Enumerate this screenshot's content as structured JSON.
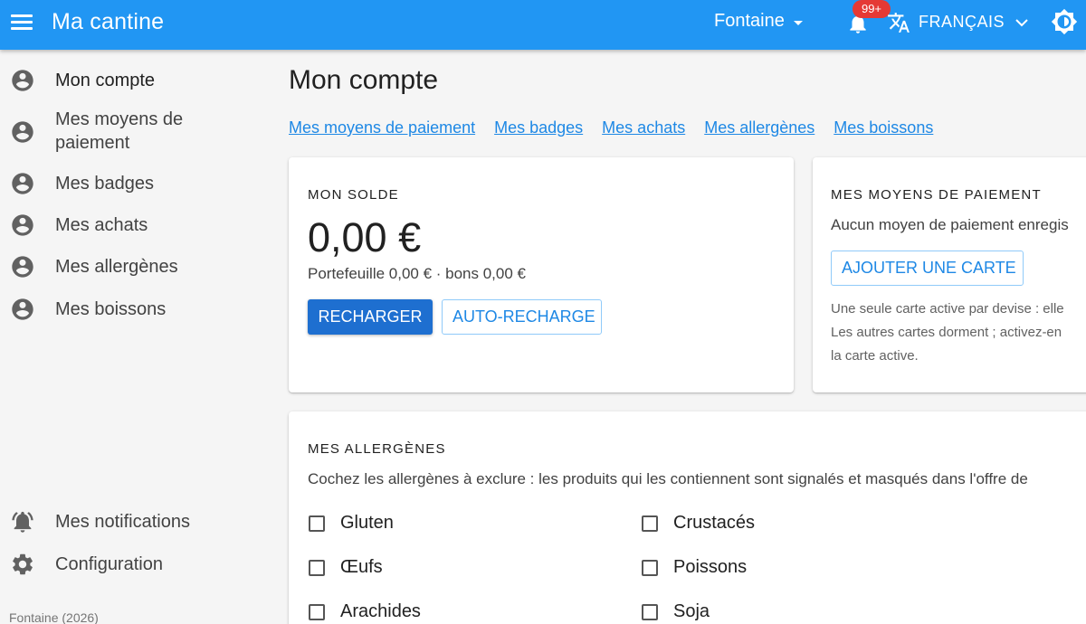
{
  "appbar": {
    "title": "Ma cantine",
    "site": "Fontaine",
    "notif_count": "99+",
    "language": "FRANÇAIS"
  },
  "sidebar": {
    "items": [
      {
        "label": "Mon compte",
        "icon": "account-circle-icon",
        "active": true
      },
      {
        "label": "Mes moyens de paiement",
        "icon": "account-circle-icon"
      },
      {
        "label": "Mes badges",
        "icon": "account-circle-icon"
      },
      {
        "label": "Mes achats",
        "icon": "account-circle-icon"
      },
      {
        "label": "Mes allergènes",
        "icon": "account-circle-icon"
      },
      {
        "label": "Mes boissons",
        "icon": "account-circle-icon"
      }
    ],
    "bottom_items": [
      {
        "label": "Mes notifications",
        "icon": "bell-ring-icon"
      },
      {
        "label": "Configuration",
        "icon": "gear-icon"
      }
    ],
    "footer": "Fontaine (2026)"
  },
  "main": {
    "title": "Mon compte",
    "links": [
      "Mes moyens de paiement",
      "Mes badges",
      "Mes achats",
      "Mes allergènes",
      "Mes boissons"
    ],
    "balance_card": {
      "title": "MON SOLDE",
      "amount": "0,00 €",
      "detail": "Portefeuille 0,00 € · bons 0,00 €",
      "recharge_label": "RECHARGER",
      "auto_recharge_label": "AUTO-RECHARGE"
    },
    "payment_card": {
      "title": "MES MOYENS DE PAIEMENT",
      "empty_text": "Aucun moyen de paiement enregis",
      "add_card_label": "AJOUTER UNE CARTE",
      "note_line1": "Une seule carte active par devise : elle",
      "note_line2": "Les autres cartes dorment ; activez-en",
      "note_line3": "la carte active."
    },
    "allergen_card": {
      "title": "MES ALLERGÈNES",
      "description": "Cochez les allergènes à exclure : les produits qui les contiennent sont signalés et masqués dans l'offre de",
      "items": [
        {
          "label": "Gluten",
          "checked": false
        },
        {
          "label": "Crustacés",
          "checked": false
        },
        {
          "label": "Œufs",
          "checked": false
        },
        {
          "label": "Poissons",
          "checked": false
        },
        {
          "label": "Arachides",
          "checked": false
        },
        {
          "label": "Soja",
          "checked": false
        }
      ]
    }
  },
  "colors": {
    "appbar": "#2196f3",
    "primary_button": "#1e6fd0",
    "link": "#1e88e5",
    "badge": "#e53935"
  }
}
